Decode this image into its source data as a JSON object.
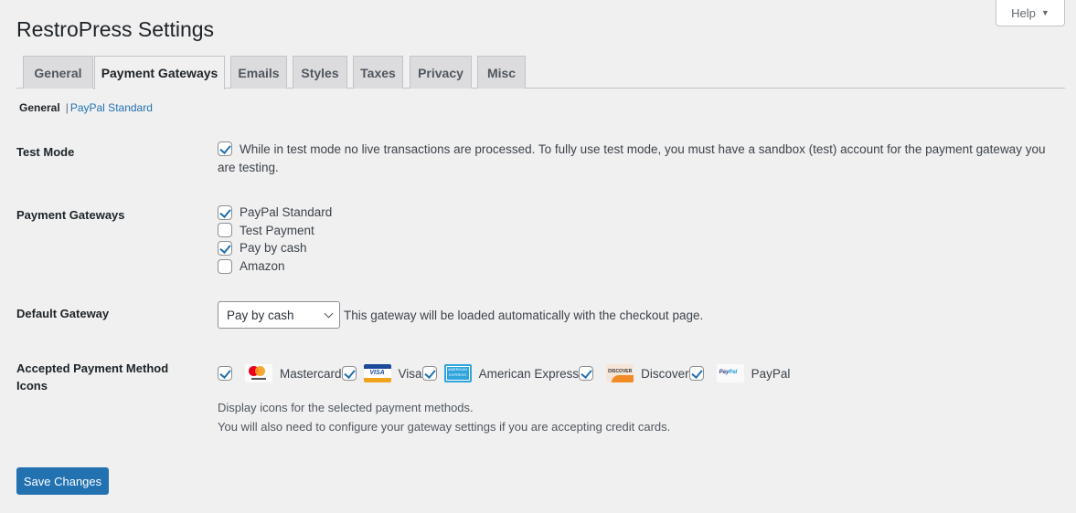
{
  "header": {
    "title": "RestroPress Settings",
    "help_label": "Help",
    "help_arrow": "▼"
  },
  "tabs": [
    {
      "label": "General",
      "active": false
    },
    {
      "label": "Payment Gateways",
      "active": true
    },
    {
      "label": "Emails",
      "active": false
    },
    {
      "label": "Styles",
      "active": false
    },
    {
      "label": "Taxes",
      "active": false
    },
    {
      "label": "Privacy",
      "active": false
    },
    {
      "label": "Misc",
      "active": false
    }
  ],
  "subnav": {
    "current": "General",
    "separator": "|",
    "link": "PayPal Standard"
  },
  "test_mode": {
    "label": "Test Mode",
    "checked": true,
    "description": "While in test mode no live transactions are processed. To fully use test mode, you must have a sandbox (test) account for the payment gateway you are testing."
  },
  "payment_gateways": {
    "label": "Payment Gateways",
    "items": [
      {
        "label": "PayPal Standard",
        "checked": true
      },
      {
        "label": "Test Payment",
        "checked": false
      },
      {
        "label": "Pay by cash",
        "checked": true
      },
      {
        "label": "Amazon",
        "checked": false
      }
    ]
  },
  "default_gateway": {
    "label": "Default Gateway",
    "selected": "Pay by cash",
    "description": "This gateway will be loaded automatically with the checkout page."
  },
  "accepted_icons": {
    "label": "Accepted Payment Method Icons",
    "items": [
      {
        "label": "Mastercard",
        "checked": true,
        "icon": "mastercard-icon"
      },
      {
        "label": "Visa",
        "checked": true,
        "icon": "visa-icon",
        "icon_text": "VISA"
      },
      {
        "label": "American Express",
        "checked": true,
        "icon": "amex-icon",
        "icon_text": "AMERICAN EXPRESS"
      },
      {
        "label": "Discover",
        "checked": true,
        "icon": "discover-icon",
        "icon_text": "DISCOVER"
      },
      {
        "label": "PayPal",
        "checked": true,
        "icon": "paypal-icon",
        "icon_text_a": "Pay",
        "icon_text_b": "Pal"
      }
    ],
    "description_lines": [
      "Display icons for the selected payment methods.",
      "You will also need to configure your gateway settings if you are accepting credit cards."
    ]
  },
  "save_button": "Save Changes",
  "colors": {
    "accent": "#2271b1",
    "background": "#f0f0f1"
  }
}
